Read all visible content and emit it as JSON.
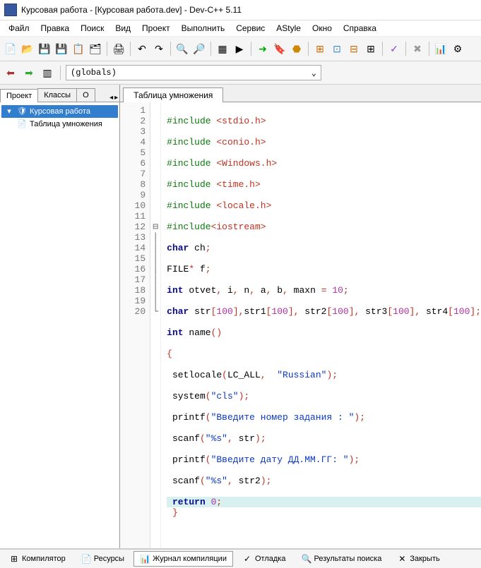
{
  "window": {
    "title": "Курсовая работа - [Курсовая работа.dev] - Dev-C++ 5.11"
  },
  "menu": [
    "Файл",
    "Правка",
    "Поиск",
    "Вид",
    "Проект",
    "Выполнить",
    "Сервис",
    "AStyle",
    "Окно",
    "Справка"
  ],
  "globals": "(globals)",
  "sidebar_tabs": {
    "t0": "Проект",
    "t1": "Классы",
    "t2": "О"
  },
  "tree": {
    "root": "Курсовая работа",
    "child": "Таблица умножения"
  },
  "editor_tab": "Таблица умножения",
  "gutter": [
    "1",
    "2",
    "3",
    "4",
    "5",
    "6",
    "7",
    "8",
    "9",
    "10",
    "11",
    "12",
    "13",
    "14",
    "15",
    "16",
    "17",
    "18",
    "19",
    "20"
  ],
  "fold": {
    "line12": "⊟"
  },
  "code": {
    "l1a": "#include ",
    "l1b": "<stdio.h>",
    "l2a": "#include ",
    "l2b": "<conio.h>",
    "l3a": "#include ",
    "l3b": "<Windows.h>",
    "l4a": "#include ",
    "l4b": "<time.h>",
    "l5a": "#include ",
    "l5b": "<locale.h>",
    "l6a": "#include",
    "l6b": "<iostream>",
    "l7a": "char",
    "l7b": " ch",
    "l7c": ";",
    "l8a": "FILE",
    "l8b": "*",
    "l8c": " f",
    "l8d": ";",
    "l9a": "int",
    "l9b": " otvet",
    "l9c": ",",
    "l9d": " i",
    "l9e": ",",
    "l9f": " n",
    "l9g": ",",
    "l9h": " a",
    "l9i": ",",
    "l9j": " b",
    "l9k": ",",
    "l9l": " maxn ",
    "l9m": "=",
    "l9n": " ",
    "l9o": "10",
    "l9p": ";",
    "l10a": "char",
    "l10b": " str",
    "l10c": "[",
    "l10d": "100",
    "l10e": "],",
    "l10f": "str1",
    "l10g": "[",
    "l10h": "100",
    "l10i": "],",
    "l10j": " str2",
    "l10k": "[",
    "l10l": "100",
    "l10m": "],",
    "l10n": " str3",
    "l10o": "[",
    "l10p": "100",
    "l10q": "],",
    "l10r": " str4",
    "l10s": "[",
    "l10t": "100",
    "l10u": "];",
    "l11a": "int",
    "l11b": " name",
    "l11c": "()",
    "l12a": "{",
    "l13a": " setlocale",
    "l13b": "(",
    "l13c": "LC_ALL",
    "l13d": ",",
    "l13e": "  ",
    "l13f": "\"Russian\"",
    "l13g": ");",
    "l14a": " system",
    "l14b": "(",
    "l14c": "\"cls\"",
    "l14d": ");",
    "l15a": " printf",
    "l15b": "(",
    "l15c": "\"Введите номер задания : \"",
    "l15d": ");",
    "l16a": " scanf",
    "l16b": "(",
    "l16c": "\"%s\"",
    "l16d": ",",
    "l16e": " str",
    "l16f": ");",
    "l17a": " printf",
    "l17b": "(",
    "l17c": "\"Введите дату ДД.ММ.ГГ: \"",
    "l17d": ");",
    "l18a": " scanf",
    "l18b": "(",
    "l18c": "\"%s\"",
    "l18d": ",",
    "l18e": " str2",
    "l18f": ");",
    "l19a": " ",
    "l19b": "return",
    "l19c": " ",
    "l19d": "0",
    "l19e": ";",
    "l20a": " }"
  },
  "bottom": {
    "t0": "Компилятор",
    "t1": "Ресурсы",
    "t2": "Журнал компиляции",
    "t3": "Отладка",
    "t4": "Результаты поиска",
    "t5": "Закрыть"
  }
}
